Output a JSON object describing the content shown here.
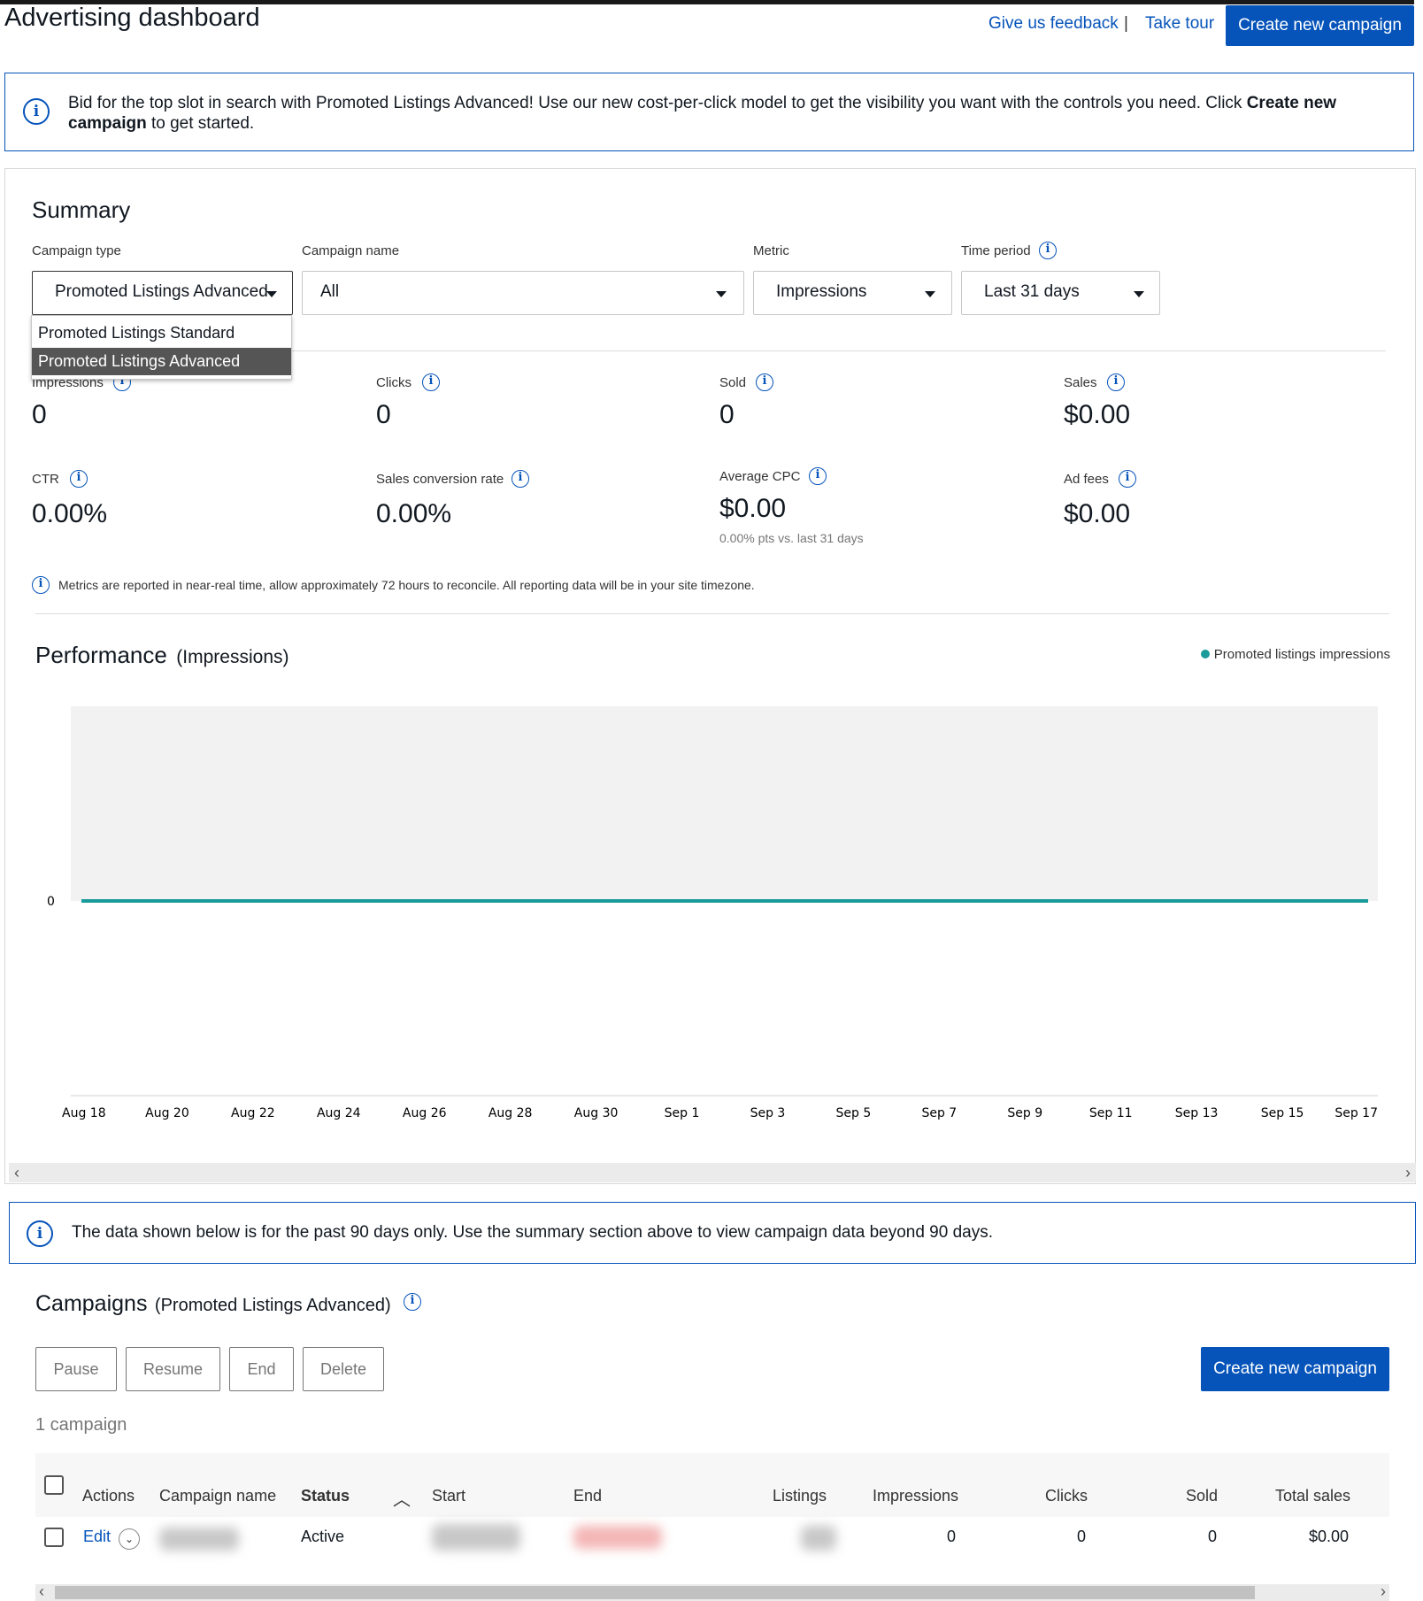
{
  "header": {
    "title": "Advertising dashboard",
    "feedback_link": "Give us feedback",
    "separator": "|",
    "tour_link": "Take tour",
    "create_button": "Create new campaign"
  },
  "promo_banner": {
    "text_start": "Bid for the top slot in search with Promoted Listings Advanced! Use our new cost-per-click model to get the visibility you want with the controls you need. Click ",
    "text_bold": "Create new campaign",
    "text_end": " to get started."
  },
  "summary": {
    "title": "Summary",
    "filters": {
      "campaign_type": {
        "label": "Campaign type",
        "value": "Promoted Listings Advanced",
        "options": [
          "Promoted Listings Standard",
          "Promoted Listings Advanced"
        ],
        "selected_index": 1
      },
      "campaign_name": {
        "label": "Campaign name",
        "value": "All"
      },
      "metric": {
        "label": "Metric",
        "value": "Impressions"
      },
      "time_period": {
        "label": "Time period",
        "value": "Last 31 days"
      }
    },
    "metrics": {
      "impressions": {
        "label": "Impressions",
        "value": "0"
      },
      "clicks": {
        "label": "Clicks",
        "value": "0"
      },
      "sold": {
        "label": "Sold",
        "value": "0"
      },
      "sales": {
        "label": "Sales",
        "value": "$0.00"
      },
      "ctr": {
        "label": "CTR",
        "value": "0.00%"
      },
      "conversion": {
        "label": "Sales conversion rate",
        "value": "0.00%"
      },
      "avg_cpc": {
        "label": "Average CPC",
        "value": "$0.00",
        "delta": "0.00% pts vs. last 31 days"
      },
      "ad_fees": {
        "label": "Ad fees",
        "value": "$0.00"
      }
    },
    "note": "Metrics are reported in near-real time, allow approximately 72 hours to reconcile. All reporting data will be in your site timezone."
  },
  "performance": {
    "title": "Performance",
    "subtitle": "(Impressions)",
    "legend": "Promoted listings impressions",
    "line_color": "#1a9a9a"
  },
  "chart_data": {
    "type": "line",
    "title": "Performance",
    "subtitle": "(Impressions)",
    "x": [
      "Aug 18",
      "Aug 20",
      "Aug 22",
      "Aug 24",
      "Aug 26",
      "Aug 28",
      "Aug 30",
      "Sep 1",
      "Sep 3",
      "Sep 5",
      "Sep 7",
      "Sep 9",
      "Sep 11",
      "Sep 13",
      "Sep 15",
      "Sep 17"
    ],
    "series": [
      {
        "name": "Promoted listings impressions",
        "values": [
          0,
          0,
          0,
          0,
          0,
          0,
          0,
          0,
          0,
          0,
          0,
          0,
          0,
          0,
          0,
          0
        ]
      }
    ],
    "y_ticks": [
      "0"
    ],
    "legend_position": "top-right",
    "grid": false
  },
  "data_banner": {
    "text": "The data shown below is for the past 90 days only. Use the summary section above to view campaign data beyond 90 days."
  },
  "campaigns": {
    "title": "Campaigns",
    "subtitle": "(Promoted Listings Advanced)",
    "actions": [
      "Pause",
      "Resume",
      "End",
      "Delete"
    ],
    "create_button": "Create new campaign",
    "count": "1 campaign",
    "columns": [
      "Actions",
      "Campaign name",
      "Status",
      "Start",
      "End",
      "Listings",
      "Impressions",
      "Clicks",
      "Sold",
      "Total sales"
    ],
    "rows": [
      {
        "action": "Edit",
        "status": "Active",
        "impressions": "0",
        "clicks": "0",
        "sold": "0",
        "total_sales": "$0.00"
      }
    ]
  }
}
